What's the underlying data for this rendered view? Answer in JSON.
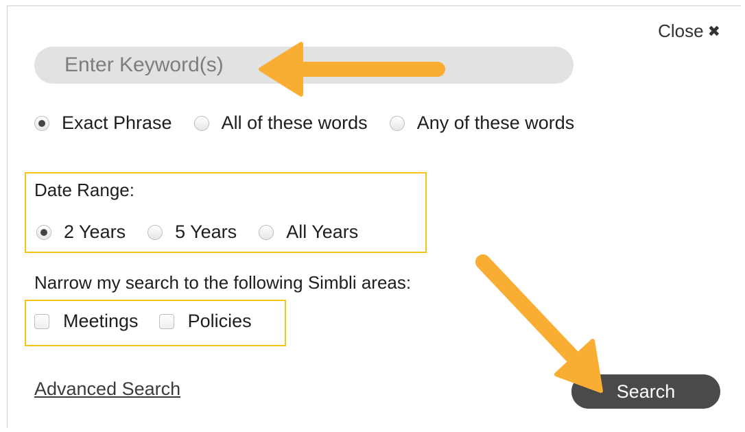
{
  "close": {
    "label": "Close",
    "icon": "close-icon"
  },
  "search_input": {
    "placeholder": "Enter Keyword(s)",
    "value": ""
  },
  "match_mode": {
    "options": [
      "Exact Phrase",
      "All of these words",
      "Any of these words"
    ],
    "selected": "Exact Phrase"
  },
  "date_range": {
    "label": "Date Range:",
    "options": [
      "2 Years",
      "5 Years",
      "All Years"
    ],
    "selected": "2 Years"
  },
  "areas": {
    "label": "Narrow my search to the following Simbli areas:",
    "options": [
      "Meetings",
      "Policies"
    ],
    "checked": []
  },
  "advanced_search": {
    "label": "Advanced Search"
  },
  "search_button": {
    "label": "Search"
  },
  "colors": {
    "annotation_arrow": "#f9ad32",
    "highlight_box": "#f6c417",
    "button_bg": "#4a4a4a",
    "input_bg": "#e2e2e2"
  }
}
